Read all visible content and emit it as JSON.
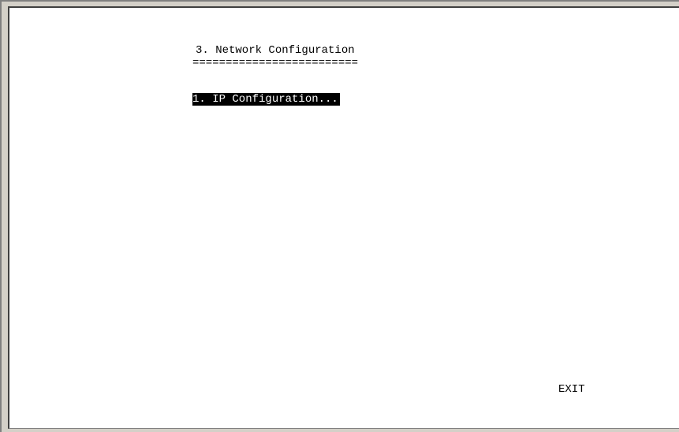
{
  "screen": {
    "title": "3. Network Configuration",
    "title_underline": "=========================",
    "menu_items": [
      {
        "label": "1. IP Configuration..."
      }
    ],
    "exit_label": "EXIT"
  },
  "colors": {
    "background": "#ffffff",
    "text": "#000000",
    "highlight_bg": "#000000",
    "highlight_fg": "#ffffff",
    "frame": "#d4d0c8"
  }
}
